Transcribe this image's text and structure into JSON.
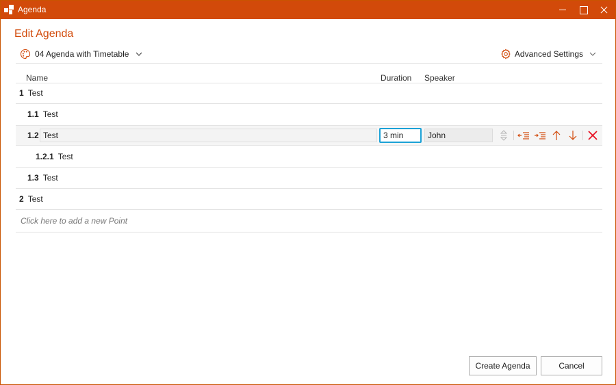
{
  "window": {
    "title": "Agenda"
  },
  "heading": "Edit Agenda",
  "template": {
    "label": "04 Agenda with Timetable",
    "icon": "palette-icon"
  },
  "advanced_settings": {
    "label": "Advanced Settings",
    "icon": "gear-icon"
  },
  "columns": {
    "name": "Name",
    "duration": "Duration",
    "speaker": "Speaker"
  },
  "rows": [
    {
      "num": "1",
      "title": "Test"
    },
    {
      "num": "1.1",
      "title": "Test"
    },
    {
      "num": "1.2",
      "title": "Test",
      "duration": "3 min",
      "speaker": "John",
      "selected": true
    },
    {
      "num": "1.2.1",
      "title": "Test"
    },
    {
      "num": "1.3",
      "title": "Test"
    },
    {
      "num": "2",
      "title": "Test"
    }
  ],
  "add_point_placeholder": "Click here to add a new Point",
  "buttons": {
    "create": "Create Agenda",
    "cancel": "Cancel"
  },
  "colors": {
    "accent": "#d24a0a",
    "focus": "#1ba1d6",
    "delete": "#e81123"
  }
}
